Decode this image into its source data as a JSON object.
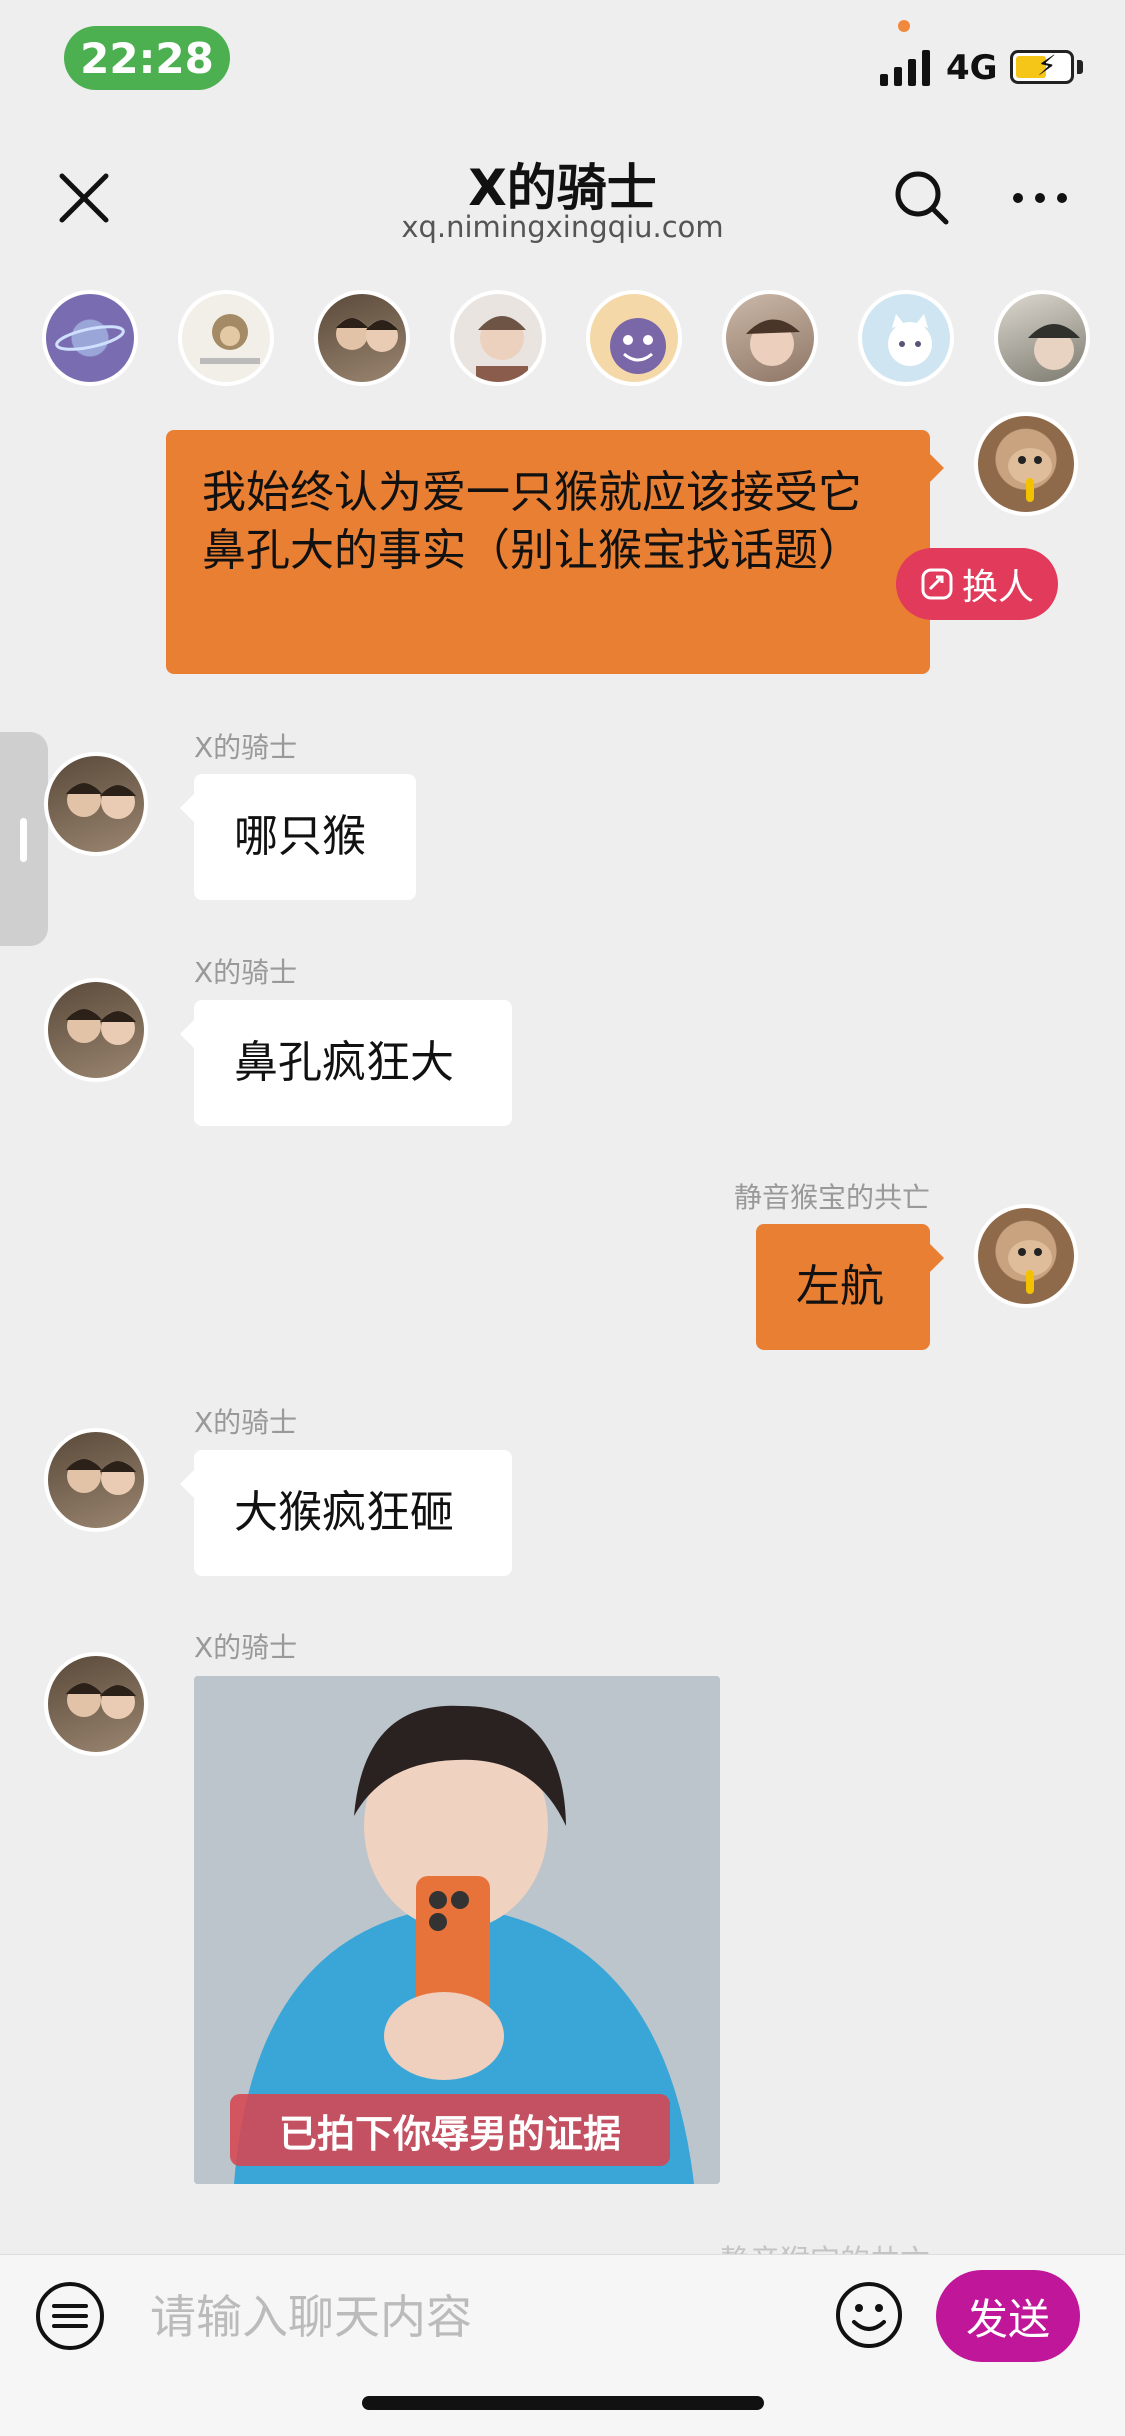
{
  "status_bar": {
    "time": "22:28",
    "network": "4G"
  },
  "header": {
    "title": "X的骑士",
    "subtitle": "xq.nimingxingqiu.com"
  },
  "avatars_row": [
    {
      "name": "planet-avatar"
    },
    {
      "name": "monkey-sticker-avatar"
    },
    {
      "name": "boy-avatar-1"
    },
    {
      "name": "boy-avatar-2"
    },
    {
      "name": "ghost-pokemon-avatar"
    },
    {
      "name": "boy-avatar-3"
    },
    {
      "name": "cat-avatar"
    },
    {
      "name": "boy-avatar-4"
    }
  ],
  "messages": [
    {
      "side": "right",
      "sender": "",
      "text": "我始终认为爱一只猴就应该接受它鼻孔大的事实（别让猴宝找话题）"
    },
    {
      "side": "left",
      "sender": "X的骑士",
      "text": "哪只猴"
    },
    {
      "side": "left",
      "sender": "X的骑士",
      "text": "鼻孔疯狂大"
    },
    {
      "side": "right",
      "sender": "静音猴宝的共亡",
      "text": "左航"
    },
    {
      "side": "left",
      "sender": "X的骑士",
      "text": "大猴疯狂砸"
    },
    {
      "side": "left",
      "sender": "X的骑士",
      "type": "image",
      "caption": "已拍下你辱男的证据"
    }
  ],
  "switch_button": {
    "label": "换人"
  },
  "peek_text": "静音猴宝的共亡",
  "input_bar": {
    "placeholder": "请输入聊天内容",
    "send_label": "发送"
  },
  "colors": {
    "self_bubble": "#e97f33",
    "other_bubble": "#ffffff",
    "send_button": "#c0169a",
    "switch_button": "#e23a5a",
    "time_pill": "#4caf50"
  }
}
